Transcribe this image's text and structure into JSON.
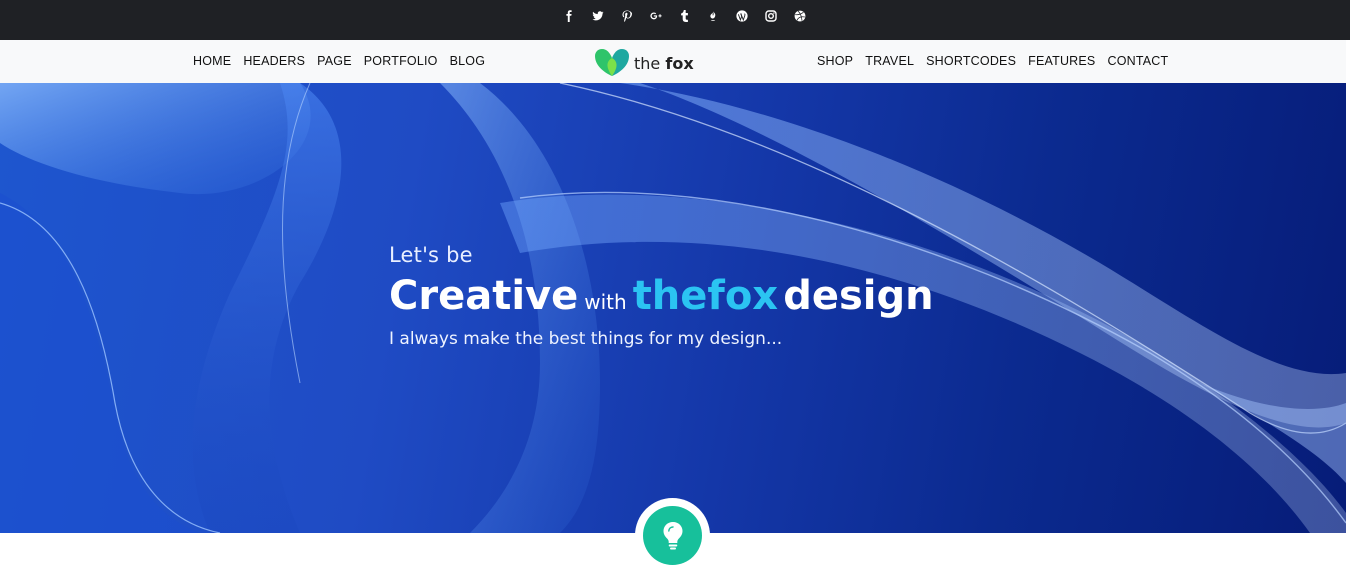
{
  "social": [
    {
      "icon": "facebook-icon",
      "glyph": "f"
    },
    {
      "icon": "twitter-icon",
      "glyph": "t"
    },
    {
      "icon": "pinterest-icon",
      "glyph": "p"
    },
    {
      "icon": "google-plus-icon",
      "glyph": "G+"
    },
    {
      "icon": "tumblr-icon",
      "glyph": "t"
    },
    {
      "icon": "foursquare-icon",
      "glyph": "4"
    },
    {
      "icon": "wordpress-icon",
      "glyph": "W"
    },
    {
      "icon": "instagram-icon",
      "glyph": "ig"
    },
    {
      "icon": "dribbble-icon",
      "glyph": "d"
    }
  ],
  "nav": {
    "left": [
      "HOME",
      "HEADERS",
      "PAGE",
      "PORTFOLIO",
      "BLOG"
    ],
    "right": [
      "SHOP",
      "TRAVEL",
      "SHORTCODES",
      "FEATURES",
      "CONTACT"
    ]
  },
  "logo": {
    "prefix": "the",
    "name": "fox"
  },
  "hero": {
    "pre": "Let's be",
    "title_big": "Creative",
    "title_small": "with",
    "title_accent": "thefox",
    "title_end": "design",
    "sub": "I always make the best things for my design..."
  },
  "badge": {
    "icon": "lightbulb-icon"
  },
  "colors": {
    "accent": "#2bc4f2",
    "badge": "#17c09b",
    "topbar": "#1f2125",
    "hero_dark": "#061c78"
  }
}
